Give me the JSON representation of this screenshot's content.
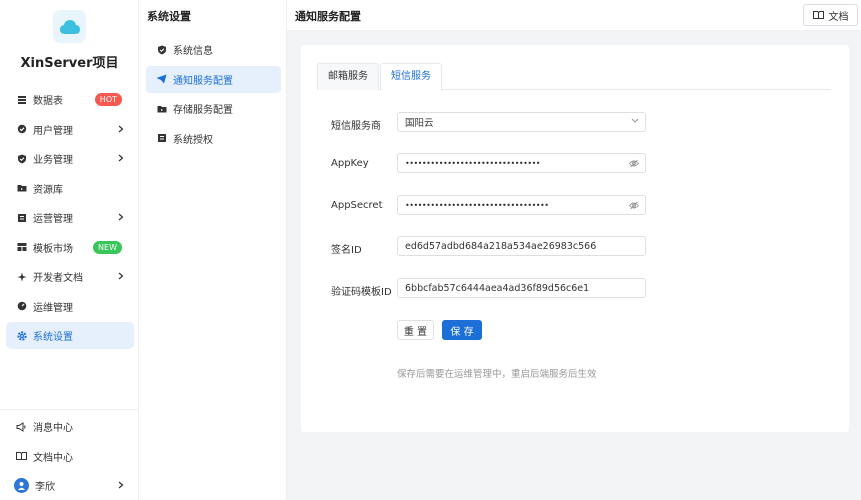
{
  "app": {
    "name": "XinServer项目"
  },
  "sidebar": {
    "items": [
      {
        "label": "数据表",
        "icon": "table-icon",
        "badge": "HOT"
      },
      {
        "label": "用户管理",
        "icon": "user-shield-icon"
      },
      {
        "label": "业务管理",
        "icon": "shield-icon"
      },
      {
        "label": "资源库",
        "icon": "folder-icon"
      },
      {
        "label": "运营管理",
        "icon": "list-icon"
      },
      {
        "label": "模板市场",
        "icon": "template-icon",
        "badge": "NEW"
      },
      {
        "label": "开发者文档",
        "icon": "code-icon"
      },
      {
        "label": "运维管理",
        "icon": "gauge-icon"
      },
      {
        "label": "系统设置",
        "icon": "gear-icon"
      }
    ],
    "bottom": [
      {
        "label": "消息中心",
        "icon": "megaphone-icon"
      },
      {
        "label": "文档中心",
        "icon": "book-icon"
      },
      {
        "label": "李欣",
        "icon": "avatar-icon"
      }
    ]
  },
  "subnav": {
    "title": "系统设置",
    "items": [
      {
        "label": "系统信息",
        "icon": "shield-check-icon"
      },
      {
        "label": "通知服务配置",
        "icon": "send-icon"
      },
      {
        "label": "存储服务配置",
        "icon": "folder-icon"
      },
      {
        "label": "系统授权",
        "icon": "certificate-icon"
      }
    ]
  },
  "header": {
    "title": "通知服务配置",
    "doc_label": "文档"
  },
  "tabs": [
    "邮箱服务",
    "短信服务"
  ],
  "form": {
    "provider": {
      "label": "短信服务商",
      "value": "国阳云"
    },
    "appkey": {
      "label": "AppKey",
      "value": "••••••••••••••••••••••••••••••••"
    },
    "appsecret": {
      "label": "AppSecret",
      "value": "••••••••••••••••••••••••••••••••••"
    },
    "sign": {
      "label": "签名ID",
      "value": "ed6d57adbd684a218a534ae26983c566"
    },
    "template": {
      "label": "验证码模板ID",
      "value": "6bbcfab57c6444aea4ad36f89d56c6e1"
    },
    "reset_label": "重 置",
    "save_label": "保 存",
    "hint": "保存后需要在运维管理中，重启后端服务后生效"
  },
  "colors": {
    "accent": "#1c6fd6",
    "hot": "#f5594f",
    "new": "#38c559"
  }
}
